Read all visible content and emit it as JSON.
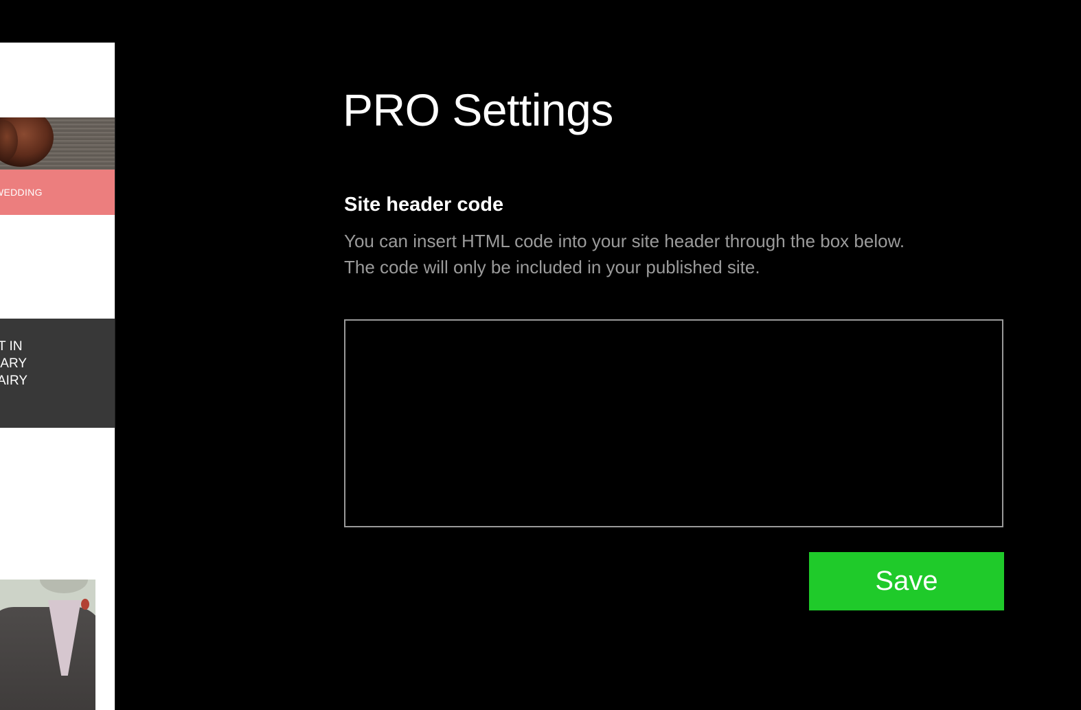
{
  "preview": {
    "pink_banner_text": "WEDDING",
    "dark_block_lines": [
      "T IN",
      "IARY",
      "AIRY"
    ]
  },
  "settings": {
    "title": "PRO Settings",
    "section_title": "Site header code",
    "description_line1": "You can insert HTML code into your site header through the box below.",
    "description_line2": "The code will only be included in your published site.",
    "code_value": "",
    "save_label": "Save"
  },
  "colors": {
    "background": "#000000",
    "save_button": "#1fca2a",
    "description_text": "#9b9b9b",
    "pink_banner": "#ec7e7e",
    "dark_block": "#383838"
  }
}
